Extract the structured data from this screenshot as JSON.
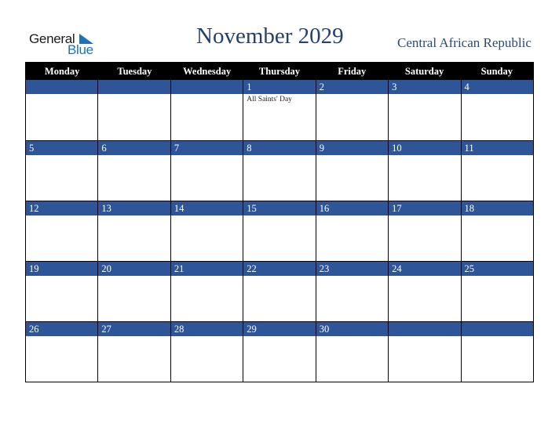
{
  "logo": {
    "word1": "General",
    "word2": "Blue"
  },
  "header": {
    "title": "November 2029",
    "country": "Central African Republic"
  },
  "colors": {
    "band": "#2e5597",
    "title": "#24406c",
    "logo_blue": "#1f72b8"
  },
  "weekdays": [
    "Monday",
    "Tuesday",
    "Wednesday",
    "Thursday",
    "Friday",
    "Saturday",
    "Sunday"
  ],
  "weeks": [
    [
      {
        "day": "",
        "event": ""
      },
      {
        "day": "",
        "event": ""
      },
      {
        "day": "",
        "event": ""
      },
      {
        "day": "1",
        "event": "All Saints' Day"
      },
      {
        "day": "2",
        "event": ""
      },
      {
        "day": "3",
        "event": ""
      },
      {
        "day": "4",
        "event": ""
      }
    ],
    [
      {
        "day": "5",
        "event": ""
      },
      {
        "day": "6",
        "event": ""
      },
      {
        "day": "7",
        "event": ""
      },
      {
        "day": "8",
        "event": ""
      },
      {
        "day": "9",
        "event": ""
      },
      {
        "day": "10",
        "event": ""
      },
      {
        "day": "11",
        "event": ""
      }
    ],
    [
      {
        "day": "12",
        "event": ""
      },
      {
        "day": "13",
        "event": ""
      },
      {
        "day": "14",
        "event": ""
      },
      {
        "day": "15",
        "event": ""
      },
      {
        "day": "16",
        "event": ""
      },
      {
        "day": "17",
        "event": ""
      },
      {
        "day": "18",
        "event": ""
      }
    ],
    [
      {
        "day": "19",
        "event": ""
      },
      {
        "day": "20",
        "event": ""
      },
      {
        "day": "21",
        "event": ""
      },
      {
        "day": "22",
        "event": ""
      },
      {
        "day": "23",
        "event": ""
      },
      {
        "day": "24",
        "event": ""
      },
      {
        "day": "25",
        "event": ""
      }
    ],
    [
      {
        "day": "26",
        "event": ""
      },
      {
        "day": "27",
        "event": ""
      },
      {
        "day": "28",
        "event": ""
      },
      {
        "day": "29",
        "event": ""
      },
      {
        "day": "30",
        "event": ""
      },
      {
        "day": "",
        "event": ""
      },
      {
        "day": "",
        "event": ""
      }
    ]
  ]
}
